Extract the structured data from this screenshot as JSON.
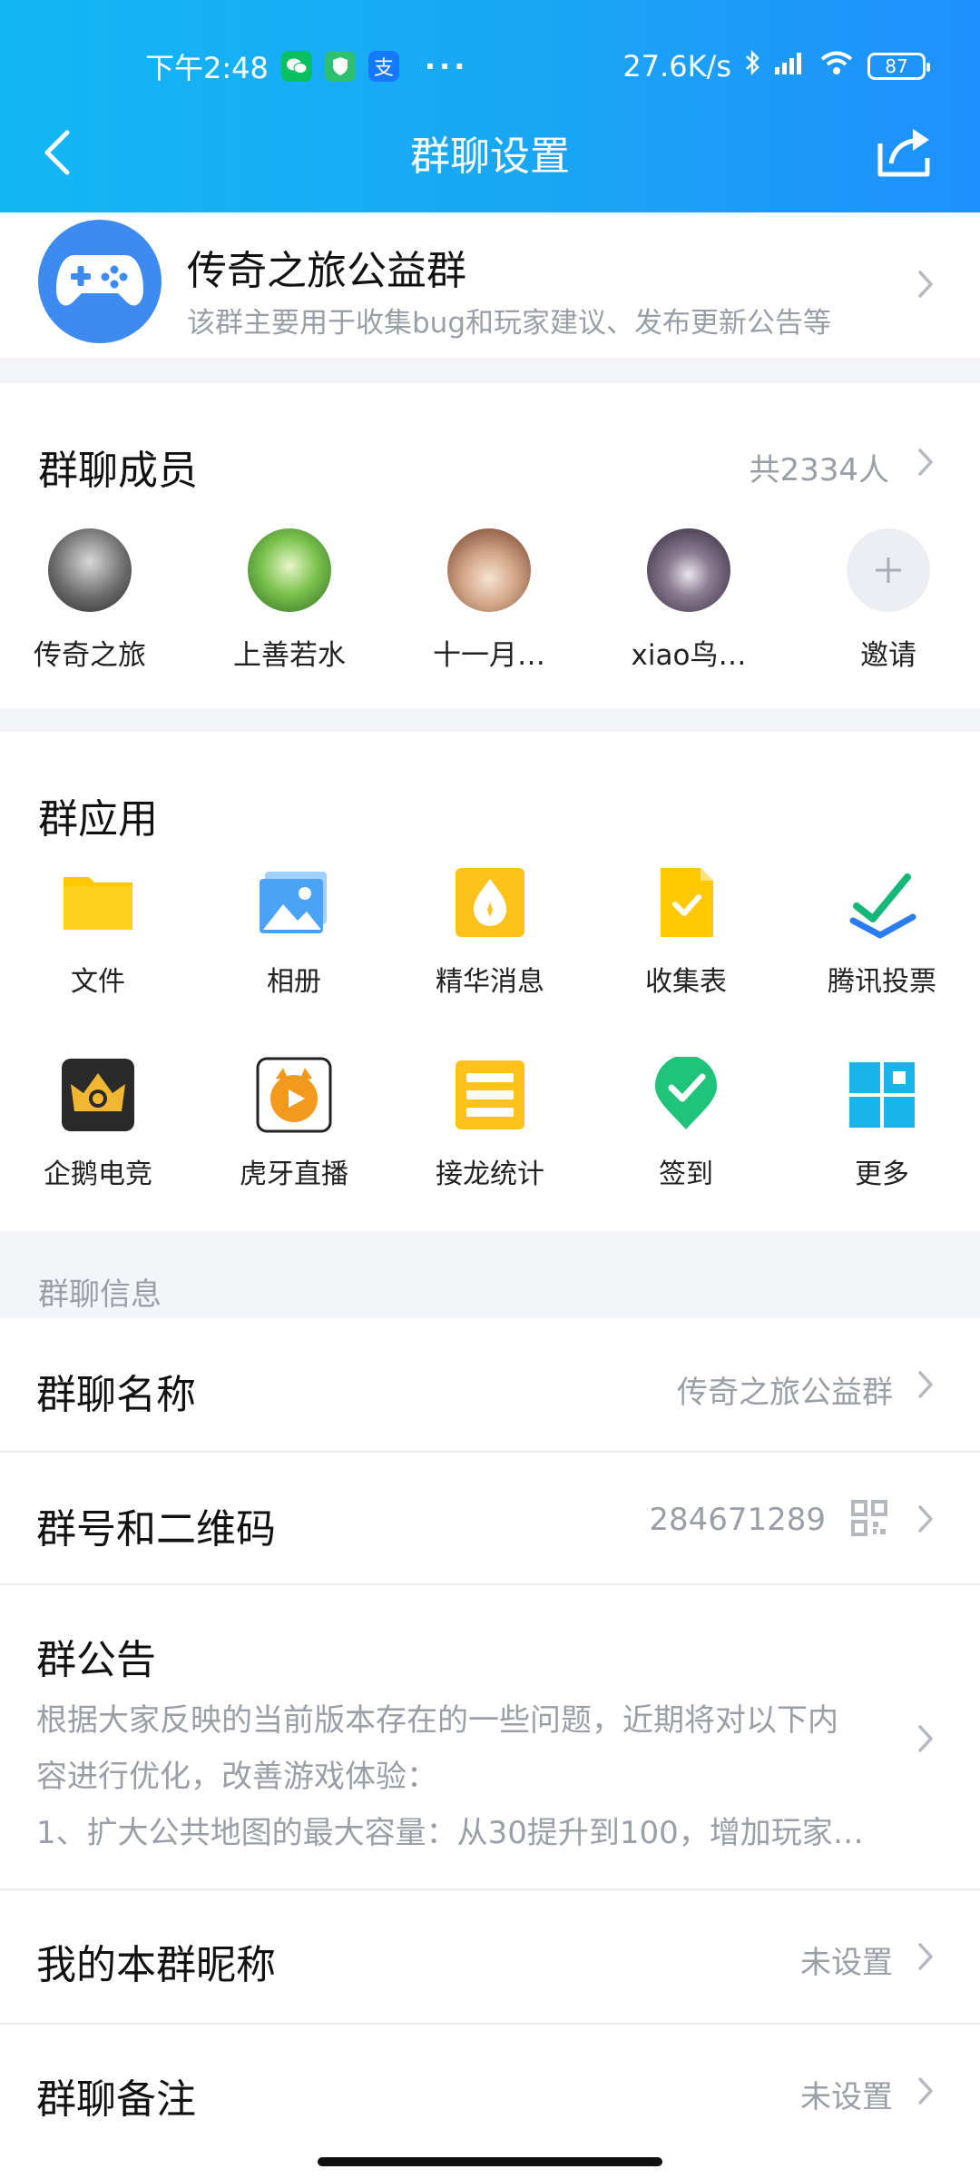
{
  "status_bar": {
    "time": "下午2:48",
    "net_speed": "27.6K/s",
    "battery": "87",
    "dots": "···",
    "app_badges": [
      {
        "name": "wechat-icon",
        "color": "#07c160"
      },
      {
        "name": "shield-icon",
        "color": "#2fbf71"
      },
      {
        "name": "alipay-icon",
        "color": "#1677ff",
        "glyph": "支"
      }
    ]
  },
  "header": {
    "title": "群聊设置"
  },
  "group": {
    "name": "传奇之旅公益群",
    "desc": "该群主要用于收集bug和玩家建议、发布更新公告等"
  },
  "members": {
    "title": "群聊成员",
    "count": "共2334人",
    "list": [
      {
        "name": "传奇之旅",
        "color": "#5a5a5a"
      },
      {
        "name": "上善若水",
        "color": "#5aa84a"
      },
      {
        "name": "十一月…",
        "color": "#a9785a"
      },
      {
        "name": "xiao鸟…",
        "color": "#4b3a55"
      }
    ],
    "invite": "邀请"
  },
  "apps": {
    "title": "群应用",
    "items": [
      {
        "label": "文件",
        "icon": "folder-icon"
      },
      {
        "label": "相册",
        "icon": "album-icon"
      },
      {
        "label": "精华消息",
        "icon": "essence-icon"
      },
      {
        "label": "收集表",
        "icon": "form-icon"
      },
      {
        "label": "腾讯投票",
        "icon": "vote-icon"
      },
      {
        "label": "企鹅电竞",
        "icon": "esports-icon"
      },
      {
        "label": "虎牙直播",
        "icon": "huya-icon"
      },
      {
        "label": "接龙统计",
        "icon": "chain-stats-icon"
      },
      {
        "label": "签到",
        "icon": "checkin-icon"
      },
      {
        "label": "更多",
        "icon": "more-apps-icon"
      }
    ]
  },
  "info": {
    "header": "群聊信息",
    "name_label": "群聊名称",
    "name_value": "传奇之旅公益群",
    "id_label": "群号和二维码",
    "id_value": "284671289",
    "notice_label": "群公告",
    "notice_lines": [
      "根据大家反映的当前版本存在的一些问题，近期将对以下内",
      "容进行优化，改善游戏体验：",
      "1、扩大公共地图的最大容量：从30提升到100，增加玩家…"
    ],
    "nickname_label": "我的本群昵称",
    "nickname_value": "未设置",
    "remark_label": "群聊备注",
    "remark_value": "未设置"
  },
  "colors": {
    "accent": "#12b7f5",
    "accent_end": "#1e90ff",
    "muted": "#9a9ea6"
  }
}
